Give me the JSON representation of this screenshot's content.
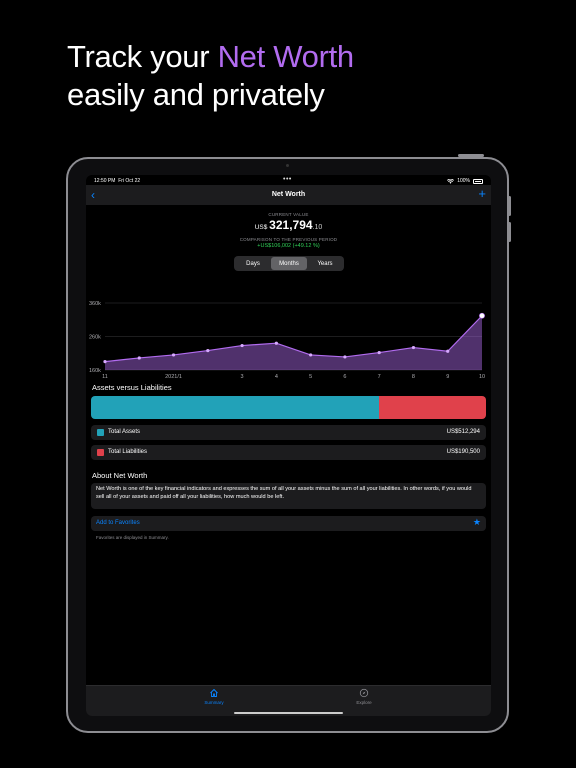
{
  "headline": {
    "line1_prefix": "Track your ",
    "line1_accent": "Net Worth",
    "line2": "easily and privately"
  },
  "status": {
    "time": "12:50 PM",
    "date": "Fri Oct 22",
    "dots": "•••",
    "battery_text": "100%"
  },
  "nav": {
    "back": "‹",
    "title": "Net Worth",
    "plus": "+"
  },
  "current": {
    "label": "CURRENT VALUE",
    "currency": "US$",
    "whole": "321,794",
    "decimals": ".10",
    "comparison_label": "COMPARISON TO THE PREVIOUS PERIOD",
    "comparison_value": "+US$106,002 (+49.12 %)"
  },
  "segments": {
    "items": [
      "Days",
      "Months",
      "Years"
    ],
    "active": "Months"
  },
  "colors": {
    "accent": "#b26cf0",
    "assets": "#22a2b8",
    "liabilities": "#e0414b",
    "link": "#0a84ff",
    "positive": "#30d158"
  },
  "chart_data": {
    "type": "area",
    "y_tick_labels": [
      "360k",
      "260k",
      "160k"
    ],
    "y_ticks": [
      360000,
      260000,
      160000
    ],
    "ylim": [
      160000,
      360000
    ],
    "x_tick_labels": [
      "11",
      "2021/1",
      "3",
      "4",
      "5",
      "6",
      "7",
      "8",
      "9",
      "10"
    ],
    "x": [
      0,
      1,
      2,
      3,
      4,
      5,
      6,
      7,
      8,
      9,
      10,
      11
    ],
    "x_tick_positions": [
      0,
      2,
      4,
      5,
      6,
      7,
      8,
      9,
      10,
      11
    ],
    "values": [
      185000,
      196000,
      205000,
      218000,
      233000,
      240000,
      205000,
      199000,
      212000,
      227000,
      216000,
      322000
    ],
    "series": [
      {
        "values": [
          185000,
          196000,
          205000,
          218000,
          233000,
          240000,
          205000,
          199000,
          212000,
          227000,
          216000,
          322000
        ]
      }
    ],
    "color": "#b26cf0",
    "grid": true
  },
  "assets_vs_liabilities": {
    "title": "Assets versus Liabilities",
    "assets_fraction": 0.729,
    "assets_label": "Total Assets",
    "assets_value": "US$512,294",
    "liabilities_label": "Total Liabilities",
    "liabilities_value": "US$190,500"
  },
  "about": {
    "title": "About Net Worth",
    "text": "Net Worth is one of the key financial indicators and expresses the sum of all your assets minus the sum of all your liabilities. In other words, if you would sell all of your assets and paid off all your liabilities, how much would be left."
  },
  "favorites": {
    "label": "Add to Favorites",
    "note": "Favorites are displayed in Summary."
  },
  "tabs": {
    "summary": "Summary",
    "explore": "Explore"
  }
}
